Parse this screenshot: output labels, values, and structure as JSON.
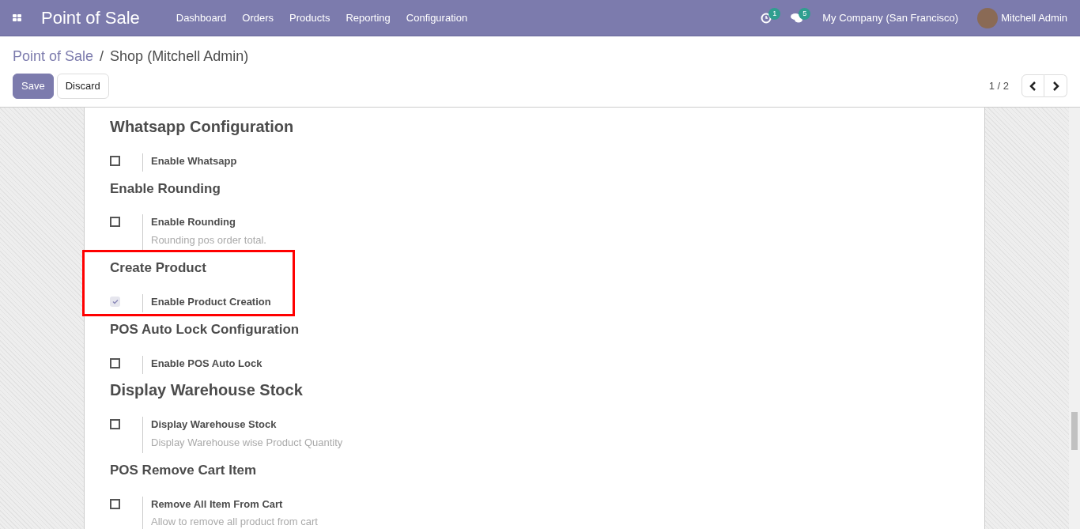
{
  "navbar": {
    "app_title": "Point of Sale",
    "menu": [
      "Dashboard",
      "Orders",
      "Products",
      "Reporting",
      "Configuration"
    ],
    "activity_count": "1",
    "message_count": "5",
    "company": "My Company (San Francisco)",
    "user": "Mitchell Admin"
  },
  "breadcrumb_separator": "/",
  "breadcrumb": [
    {
      "label": "Point of Sale",
      "kind": "link"
    },
    {
      "label": "Shop (Mitchell Admin)",
      "kind": "current"
    }
  ],
  "buttons": [
    {
      "label": "Save",
      "kind": "primary"
    },
    {
      "label": "Discard",
      "kind": "secondary"
    }
  ],
  "pager": {
    "text": "1 / 2"
  },
  "sections": [
    {
      "title": "Whatsapp Configuration",
      "kind": "large",
      "highlighted": false,
      "options": [
        {
          "label": "Enable Whatsapp",
          "checked": false,
          "disabled": false
        }
      ]
    },
    {
      "title": "Enable Rounding",
      "kind": "small",
      "highlighted": false,
      "options": [
        {
          "label": "Enable Rounding",
          "description": "Rounding pos order total.",
          "checked": false,
          "disabled": false
        }
      ]
    },
    {
      "title": "Create Product",
      "kind": "small",
      "highlighted": true,
      "options": [
        {
          "label": "Enable Product Creation",
          "checked": true,
          "disabled": true
        }
      ]
    },
    {
      "title": "POS Auto Lock Configuration",
      "kind": "small",
      "highlighted": false,
      "options": [
        {
          "label": "Enable POS Auto Lock",
          "checked": false,
          "disabled": false
        }
      ]
    },
    {
      "title": "Display Warehouse Stock",
      "kind": "large",
      "highlighted": false,
      "options": [
        {
          "label": "Display Warehouse Stock",
          "description": "Display Warehouse wise Product Quantity",
          "checked": false,
          "disabled": false
        }
      ]
    },
    {
      "title": "POS Remove Cart Item",
      "kind": "small",
      "highlighted": false,
      "options": [
        {
          "label": "Remove All Item From Cart",
          "description": "Allow to remove all product from cart",
          "checked": false,
          "disabled": false
        }
      ]
    }
  ]
}
